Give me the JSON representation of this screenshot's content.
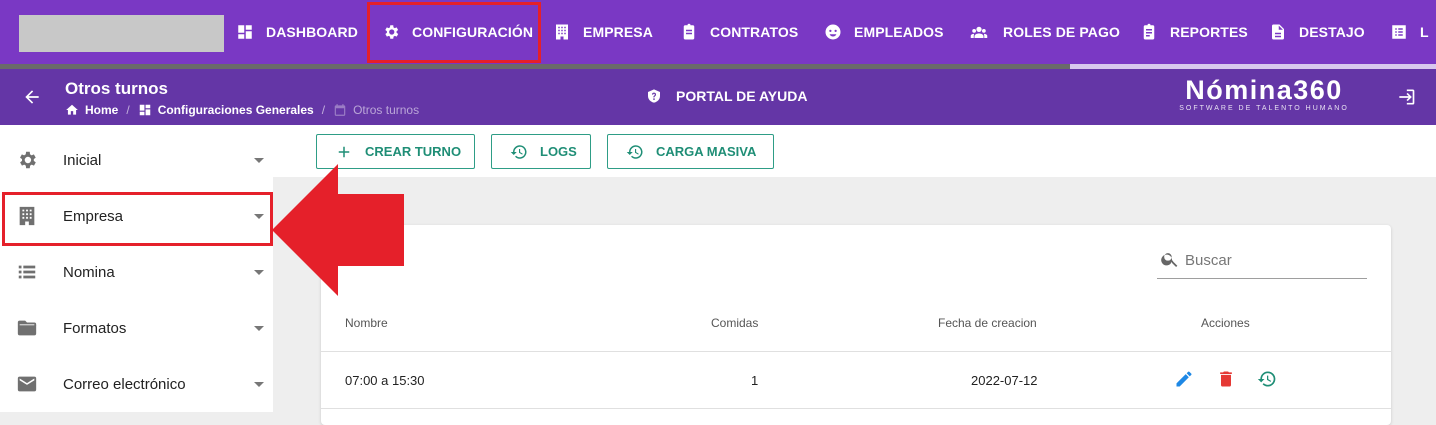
{
  "topnav": {
    "items": [
      {
        "label": "DASHBOARD",
        "icon": "dashboard-icon"
      },
      {
        "label": "CONFIGURACIÓN",
        "icon": "gear-icon"
      },
      {
        "label": "EMPRESA",
        "icon": "building-icon"
      },
      {
        "label": "CONTRATOS",
        "icon": "clipboard-icon"
      },
      {
        "label": "EMPLEADOS",
        "icon": "face-icon"
      },
      {
        "label": "ROLES DE PAGO",
        "icon": "people-icon"
      },
      {
        "label": "REPORTES",
        "icon": "clipboard-list-icon"
      },
      {
        "label": "DESTAJO",
        "icon": "document-icon"
      },
      {
        "label": "L",
        "icon": "list-icon"
      }
    ],
    "accent": "#7a38c4"
  },
  "subheader": {
    "title": "Otros turnos",
    "breadcrumb": [
      "Home",
      "Configuraciones Generales",
      "Otros turnos"
    ],
    "help_label": "PORTAL DE AYUDA",
    "brand_name": "Nómina360",
    "brand_tagline": "SOFTWARE DE TALENTO HUMANO",
    "color": "#6436a6"
  },
  "sidebar": {
    "items": [
      {
        "label": "Inicial",
        "icon": "gear-icon"
      },
      {
        "label": "Empresa",
        "icon": "building-icon"
      },
      {
        "label": "Nomina",
        "icon": "list-icon"
      },
      {
        "label": "Formatos",
        "icon": "folder-icon"
      },
      {
        "label": "Correo electrónico",
        "icon": "mail-icon"
      }
    ]
  },
  "actions": {
    "create_label": "CREAR TURNO",
    "logs_label": "LOGS",
    "bulk_label": "CARGA MASIVA",
    "color": "#1f8e76"
  },
  "table": {
    "search_placeholder": "Buscar",
    "headers": [
      "Nombre",
      "Comidas",
      "Fecha de creacion",
      "Acciones"
    ],
    "rows": [
      {
        "nombre": "07:00 a 15:30",
        "comidas": "1",
        "fecha": "2022-07-12"
      }
    ]
  },
  "annotation_color": "#e5202a"
}
